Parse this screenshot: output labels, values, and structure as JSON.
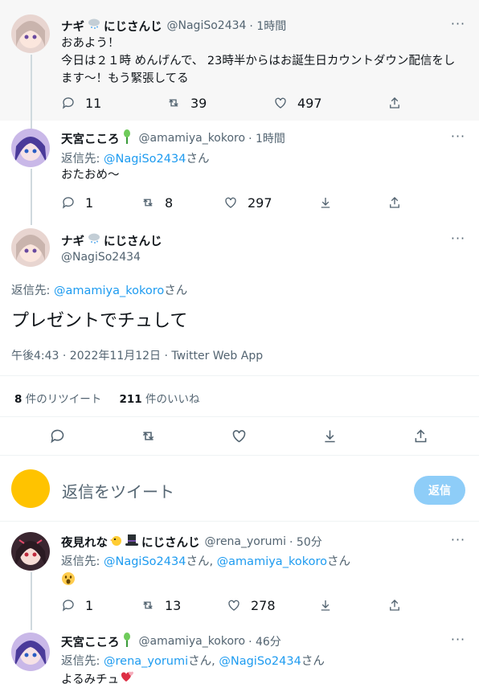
{
  "tweet1": {
    "name": "ナギ",
    "name_suffix": "にじさんじ",
    "handle": "@NagiSo2434",
    "time": "· 1時間",
    "text_line1": "おあよう！",
    "text_line2": "今日は２１時 めんげんで、 23時半からはお誕生日カウントダウン配信をし",
    "text_line3": "ます〜！もう緊張してる",
    "replies": "11",
    "retweets": "39",
    "likes": "497"
  },
  "tweet2": {
    "name": "天宮こころ",
    "handle": "@amamiya_kokoro",
    "time": "· 1時間",
    "reply_prefix": "返信先: ",
    "reply_target": "@NagiSo2434",
    "reply_suffix": "さん",
    "text": "おたおめ〜",
    "replies": "1",
    "retweets": "8",
    "likes": "297"
  },
  "main": {
    "name": "ナギ",
    "name_suffix": "にじさんじ",
    "handle": "@NagiSo2434",
    "reply_prefix": "返信先: ",
    "reply_target": "@amamiya_kokoro",
    "reply_suffix": "さん",
    "text": "プレゼントでチュして",
    "meta": "午後4:43 · 2022年11月12日 · Twitter Web App",
    "retweet_count": "8",
    "retweet_label": " 件のリツイート",
    "like_count": "211",
    "like_label": " 件のいいね"
  },
  "compose": {
    "placeholder": "返信をツイート",
    "button": "返信"
  },
  "tweet3": {
    "name": "夜見れな",
    "name_suffix": "にじさんじ",
    "handle": "@rena_yorumi",
    "time": "· 50分",
    "reply_prefix": "返信先: ",
    "reply_target1": "@NagiSo2434",
    "reply_mid": "さん, ",
    "reply_target2": "@amamiya_kokoro",
    "reply_suffix": "さん",
    "replies": "1",
    "retweets": "13",
    "likes": "278"
  },
  "tweet4": {
    "name": "天宮こころ",
    "handle": "@amamiya_kokoro",
    "time": "· 46分",
    "reply_prefix": "返信先: ",
    "reply_target1": "@rena_yorumi",
    "reply_mid": "さん, ",
    "reply_target2": "@NagiSo2434",
    "reply_suffix": "さん",
    "text": "よるみチュ"
  },
  "colors": {
    "link": "#1d9bf0",
    "muted": "#536471",
    "reply_button": "#8ecdf8",
    "compose_avatar": "#ffc300"
  },
  "icons": [
    "reply-icon",
    "retweet-icon",
    "like-icon",
    "share-icon",
    "download-icon",
    "more-icon",
    "cloud-emoji",
    "chick-emoji",
    "tophat-emoji",
    "hearts-emoji",
    "scream-emoji",
    "herb-emoji"
  ]
}
